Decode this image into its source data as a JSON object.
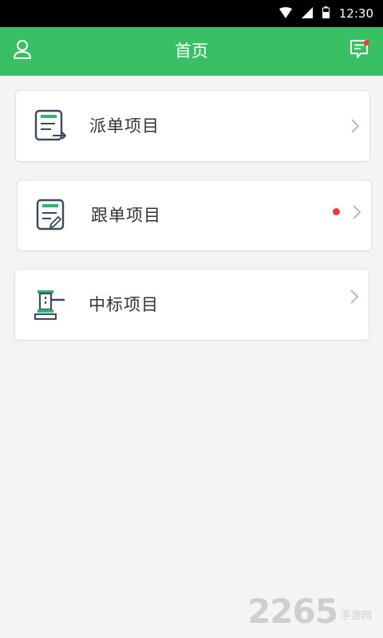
{
  "status_bar": {
    "time": "12:30"
  },
  "app_bar": {
    "title": "首页"
  },
  "cards": [
    {
      "label": "派单项目"
    },
    {
      "label": "跟单项目"
    },
    {
      "label": "中标项目"
    }
  ],
  "watermark": {
    "number": "2265",
    "text": "手游网"
  },
  "colors": {
    "primary": "#3ac064",
    "text": "#333333",
    "icon_dark": "#3b4a5c",
    "icon_green": "#2bb673",
    "badge": "#f03a3a",
    "background": "#f4f4f4"
  }
}
